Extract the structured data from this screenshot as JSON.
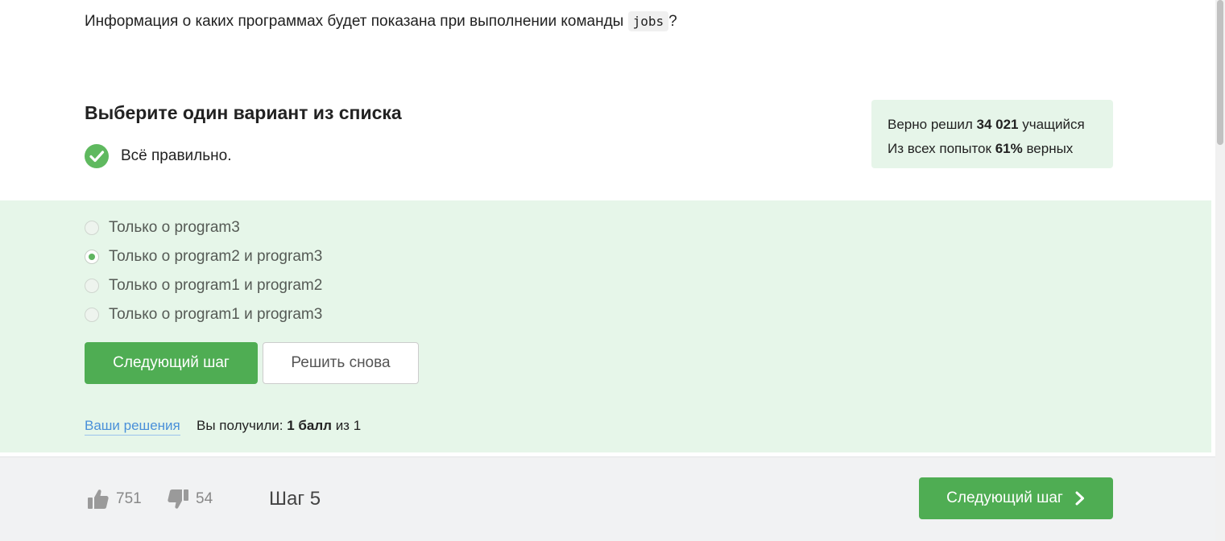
{
  "question": {
    "text_before": "Информация о каких программах будет показана при выполнении команды",
    "code": "jobs",
    "text_after": "?"
  },
  "task": {
    "heading": "Выберите один вариант из списка",
    "status_text": "Всё правильно."
  },
  "stats": {
    "solved_prefix": "Верно решил",
    "solved_count": "34 021",
    "solved_suffix": "учащийся",
    "attempts_prefix": "Из всех попыток",
    "attempts_percent": "61%",
    "attempts_suffix": "верных"
  },
  "options": [
    {
      "label": "Только о program3",
      "checked": false
    },
    {
      "label": "Только о program2 и program3",
      "checked": true
    },
    {
      "label": "Только о program1 и program2",
      "checked": false
    },
    {
      "label": "Только о program1 и program3",
      "checked": false
    }
  ],
  "buttons": {
    "next_step": "Следующий шаг",
    "solve_again": "Решить снова"
  },
  "result": {
    "solutions_link": "Ваши решения",
    "score_prefix": "Вы получили:",
    "score_value": "1 балл",
    "score_suffix": "из 1"
  },
  "footer": {
    "likes": "751",
    "dislikes": "54",
    "step_label": "Шаг 5",
    "next_button": "Следующий шаг"
  },
  "colors": {
    "accent_green": "#4fad53",
    "answer_bg": "#e6f6e9",
    "link_blue": "#4a90d9"
  },
  "icons": {
    "status": "check-circle-icon",
    "like": "thumbs-up-icon",
    "dislike": "thumbs-down-icon",
    "next": "chevron-right-icon"
  }
}
